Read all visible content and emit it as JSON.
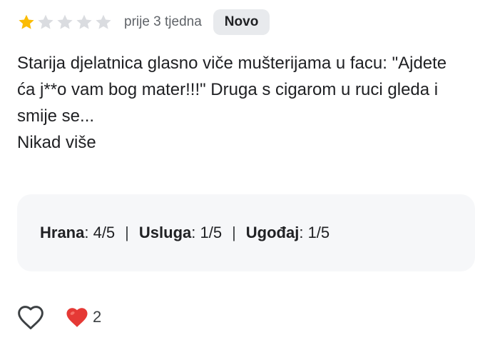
{
  "review": {
    "rating": 1,
    "rating_max": 5,
    "time_ago": "prije 3 tjedna",
    "badge": "Novo",
    "text_lines": [
      "Starija djelatnica glasno viče mušterijama u facu: \"Ajdete ća j**o vam bog mater!!!\" Druga s cigarom u ruci gleda i smije se...",
      "Nikad više"
    ]
  },
  "ratings": {
    "food_label": "Hrana",
    "food_value": ": 4/5",
    "service_label": "Usluga",
    "service_value": ": 1/5",
    "atmosphere_label": "Ugođaj",
    "atmosphere_value": ": 1/5",
    "separator": "|"
  },
  "footer": {
    "like_icon": "heart-outline-icon",
    "reaction_icon": "red-heart-icon",
    "reaction_count": "2"
  },
  "colors": {
    "star_filled": "#fbbc04",
    "star_empty": "#dadce0",
    "badge_bg": "#e8eaed",
    "panel_bg": "#f6f7f9",
    "heart_red": "#e53935"
  }
}
